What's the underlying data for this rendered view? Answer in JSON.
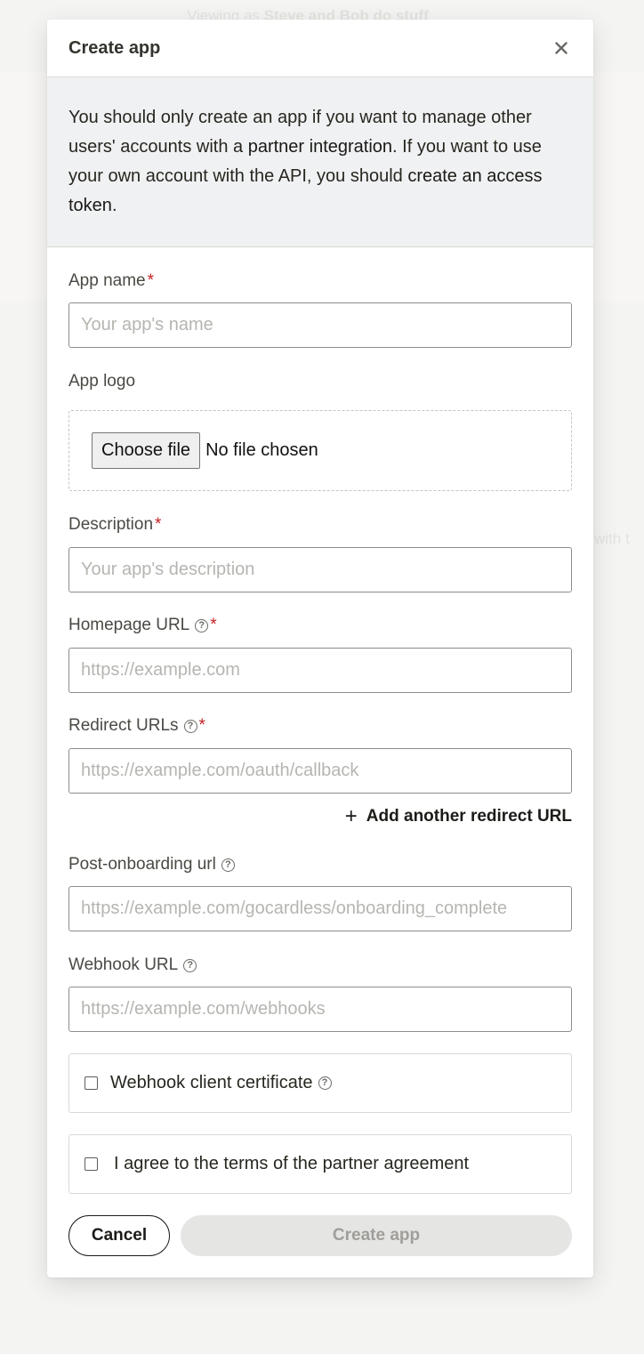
{
  "background": {
    "viewing_prefix": "Viewing as",
    "viewing_org": "Steve and Bob do stuff",
    "side_fragment": "with t"
  },
  "modal": {
    "title": "Create app",
    "close_icon": "close-icon"
  },
  "notice": {
    "text_1": "You should only create an app if you want to manage other users' accounts with a ",
    "link_partner": "partner integration",
    "text_2": ". If you want to use your own account with the API, you should ",
    "link_token": "create an access token",
    "text_3": "."
  },
  "fields": {
    "app_name": {
      "label": "App name",
      "required": "*",
      "placeholder": "Your app's name"
    },
    "app_logo": {
      "label": "App logo",
      "button": "Choose file",
      "status": "No file chosen"
    },
    "description": {
      "label": "Description",
      "required": "*",
      "placeholder": "Your app's description"
    },
    "homepage_url": {
      "label": "Homepage URL",
      "required": "*",
      "help": "?",
      "placeholder": "https://example.com"
    },
    "redirect_urls": {
      "label": "Redirect URLs",
      "required": "*",
      "help": "?",
      "placeholder": "https://example.com/oauth/callback",
      "add_label": "Add another redirect URL"
    },
    "post_onboarding": {
      "label": "Post-onboarding url",
      "help": "?",
      "placeholder": "https://example.com/gocardless/onboarding_complete"
    },
    "webhook_url": {
      "label": "Webhook URL",
      "help": "?",
      "placeholder": "https://example.com/webhooks"
    }
  },
  "checks": {
    "webhook_cert": {
      "label": "Webhook client certificate",
      "help": "?",
      "checked": false
    },
    "terms": {
      "label": "I agree to the terms of the partner agreement",
      "checked": false
    }
  },
  "actions": {
    "cancel": "Cancel",
    "create": "Create app"
  }
}
